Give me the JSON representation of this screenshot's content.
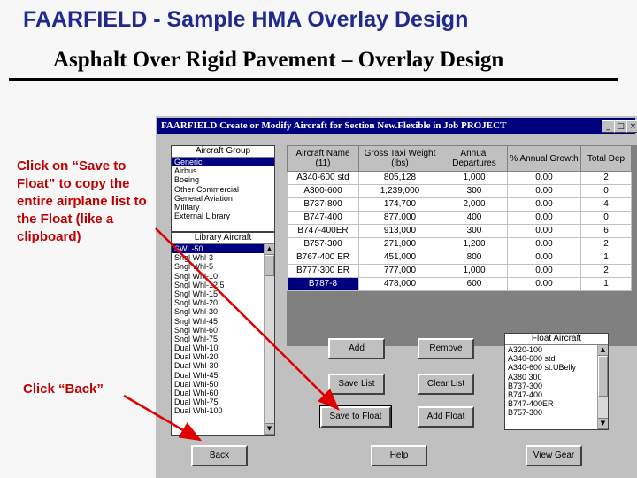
{
  "slide": {
    "title": "FAARFIELD - Sample HMA Overlay Design",
    "subtitle": "Asphalt Over Rigid Pavement – Overlay Design",
    "note_save": "Click on “Save to Float” to copy the entire airplane list to the Float (like a clipboard)",
    "note_back": "Click “Back”"
  },
  "window": {
    "title": "FAARFIELD  Create or Modify Aircraft for Section New.Flexible in Job PROJECT",
    "btn_min": "_",
    "btn_max": "□",
    "btn_close": "×"
  },
  "aircraft_group": {
    "header": "Aircraft Group",
    "items": [
      "Generic",
      "Airbus",
      "Boeing",
      "Other Commercial",
      "General Aviation",
      "Military",
      "External Library"
    ],
    "selected": 0
  },
  "library_aircraft": {
    "header": "Library Aircraft",
    "items": [
      "SWL-50",
      "Sngl Whl-3",
      "Sngl Whl-5",
      "Sngl Whl-10",
      "Sngl Whl-12.5",
      "Sngl Whl-15",
      "Sngl Whl-20",
      "Sngl Whl-30",
      "Sngl Whl-45",
      "Sngl Whl-60",
      "Sngl Whl-75",
      "Dual Whl-10",
      "Dual Whl-20",
      "Dual Whl-30",
      "Dual Whl-45",
      "Dual Whl-50",
      "Dual Whl-60",
      "Dual Whl-75",
      "Dual Whl-100"
    ],
    "selected": 0
  },
  "aircraft_table": {
    "columns": [
      "Aircraft Name (11)",
      "Gross Taxi Weight (lbs)",
      "Annual Departures",
      "% Annual Growth",
      "Total Dep"
    ],
    "rows": [
      [
        "A340-600 std",
        "805,128",
        "1,000",
        "0.00",
        "2"
      ],
      [
        "A300-600",
        "1,239,000",
        "300",
        "0.00",
        "0"
      ],
      [
        "B737-800",
        "174,700",
        "2,000",
        "0.00",
        "4"
      ],
      [
        "B747-400",
        "877,000",
        "400",
        "0.00",
        "0"
      ],
      [
        "B747-400ER",
        "913,000",
        "300",
        "0.00",
        "6"
      ],
      [
        "B757-300",
        "271,000",
        "1,200",
        "0.00",
        "2"
      ],
      [
        "B767-400 ER",
        "451,000",
        "800",
        "0.00",
        "1"
      ],
      [
        "B777-300 ER",
        "777,000",
        "1,000",
        "0.00",
        "2"
      ],
      [
        "B787-8",
        "478,000",
        "600",
        "0.00",
        "1"
      ]
    ],
    "selected_row": 8
  },
  "float_aircraft": {
    "header": "Float Aircraft",
    "items": [
      "A320-100",
      "A340-600 std",
      "A340-600 st.UBelly",
      "A380 300",
      "B737-300",
      "B747-400",
      "B747-400ER",
      "B757-300"
    ]
  },
  "buttons": {
    "add": "Add",
    "remove": "Remove",
    "save_list": "Save List",
    "clear_list": "Clear List",
    "save_to_float": "Save to Float",
    "add_float": "Add Float",
    "back": "Back",
    "help": "Help",
    "view_gear": "View Gear"
  },
  "colors": {
    "title_blue": "#1f2a8c",
    "note_red": "#c00000",
    "selection_navy": "#00007f",
    "arrow_red": "#e00000"
  }
}
